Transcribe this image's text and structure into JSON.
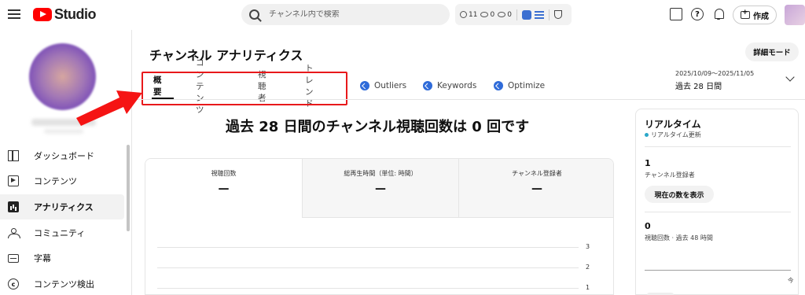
{
  "app": {
    "logo_text": "Studio"
  },
  "search": {
    "placeholder": "チャンネル内で検索"
  },
  "header_stats": {
    "count_a": "11",
    "count_b": "0",
    "count_c": "0"
  },
  "header": {
    "create_label": "作成"
  },
  "sidebar": {
    "items": [
      {
        "label": "ダッシュボード",
        "icon": "dashboard-icon"
      },
      {
        "label": "コンテンツ",
        "icon": "content-icon"
      },
      {
        "label": "アナリティクス",
        "icon": "analytics-icon",
        "active": true
      },
      {
        "label": "コミュニティ",
        "icon": "community-icon"
      },
      {
        "label": "字幕",
        "icon": "subtitles-icon"
      },
      {
        "label": "コンテンツ検出",
        "icon": "copyright-icon"
      }
    ]
  },
  "page": {
    "title": "チャンネル アナリティクス",
    "detail_mode": "詳細モード",
    "date_range": "2025/10/09～2025/11/05",
    "date_label": "過去 28 日間"
  },
  "tabs": [
    {
      "label": "概要",
      "active": true
    },
    {
      "label": "コンテンツ"
    },
    {
      "label": "視聴者"
    },
    {
      "label": "トレンド"
    },
    {
      "label": "Outliers",
      "ext": true
    },
    {
      "label": "Keywords",
      "ext": true
    },
    {
      "label": "Optimize",
      "ext": true
    }
  ],
  "summary": {
    "headline": "過去 28 日間のチャンネル視聴回数は 0 回です",
    "metrics": [
      {
        "label": "視聴回数",
        "value": "—"
      },
      {
        "label": "総再生時間（単位: 時間）",
        "value": "—"
      },
      {
        "label": "チャンネル登録者",
        "value": "—"
      }
    ],
    "chart_ticks": [
      "3",
      "2",
      "1"
    ]
  },
  "realtime": {
    "title": "リアルタイム",
    "subtitle": "リアルタイム更新",
    "subs_value": "1",
    "subs_label": "チャンネル登録者",
    "show_button": "現在の数を表示",
    "views_value": "0",
    "views_label": "視聴回数 · 過去 48 時間",
    "now_label": "今"
  },
  "colors": {
    "accent_red": "#e8191b",
    "brand_red": "#ff0000",
    "ext_blue": "#2f6bd9"
  }
}
